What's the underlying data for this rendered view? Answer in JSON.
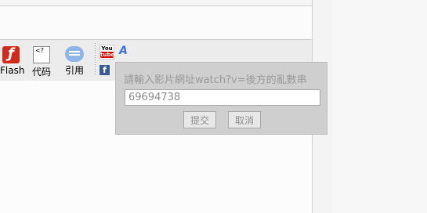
{
  "toolbar": {
    "flash_label": "Flash",
    "code_label": "代码",
    "quote_label": "引用",
    "code_glyph": "<?",
    "youtube_you": "You",
    "youtube_tube": "tube",
    "facebook_glyph": "f",
    "font_glyph": "A"
  },
  "popup": {
    "prompt": "請輸入影片網址watch?v=後方的亂數串",
    "input_value": "69694738",
    "submit_label": "提交",
    "cancel_label": "取消"
  }
}
